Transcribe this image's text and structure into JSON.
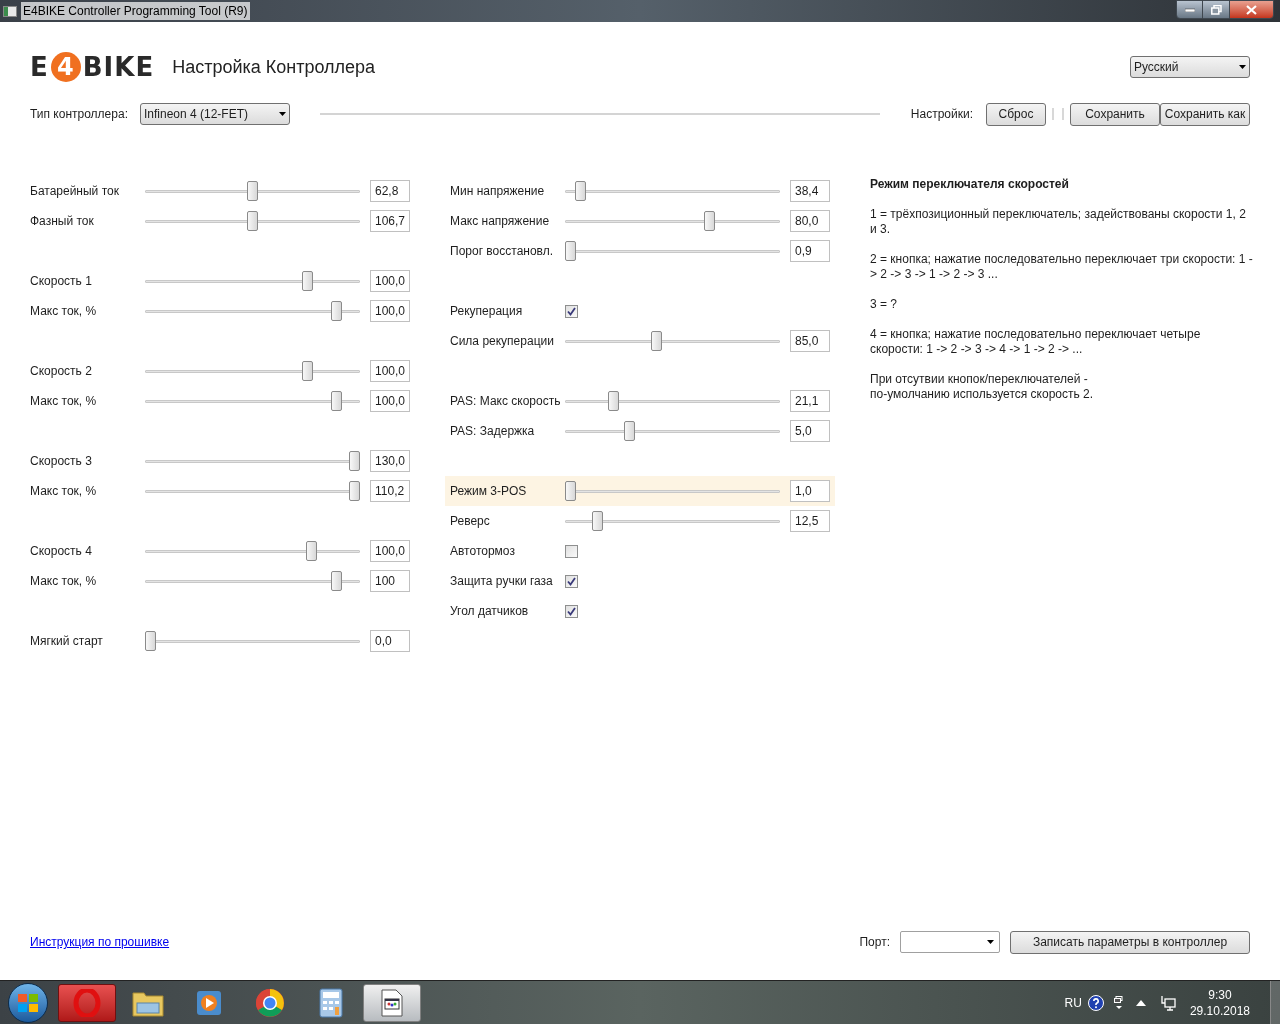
{
  "window": {
    "title": "E4BIKE Controller Programming Tool (R9)"
  },
  "header": {
    "logo": {
      "left": "E",
      "badge": "4",
      "right": "BIKE"
    },
    "title": "Настройка Контроллера",
    "language": {
      "value": "Русский"
    }
  },
  "toolbar": {
    "controller_label": "Тип контроллера:",
    "controller": {
      "value": "Infineon 4 (12-FET)"
    },
    "settings_label": "Настройки:",
    "buttons": [
      "Сброс",
      "Сохранить",
      "Сохранить как"
    ]
  },
  "columns": [
    {
      "groups": [
        [
          {
            "kind": "slider",
            "label": "Батарейный ток",
            "level": 0.5,
            "value": "62,8",
            "highlighted": false
          },
          {
            "kind": "slider",
            "label": "Фазный ток",
            "level": 0.5,
            "value": "106,7",
            "highlighted": false
          }
        ],
        [
          {
            "kind": "slider",
            "label": "Скорость 1",
            "level": 0.77,
            "value": "100,0",
            "highlighted": false
          },
          {
            "kind": "slider",
            "label": "Макс ток, %",
            "level": 0.91,
            "value": "100,0",
            "highlighted": false
          }
        ],
        [
          {
            "kind": "slider",
            "label": "Скорость 2",
            "level": 0.77,
            "value": "100,0",
            "highlighted": false
          },
          {
            "kind": "slider",
            "label": "Макс ток, %",
            "level": 0.91,
            "value": "100,0",
            "highlighted": false
          }
        ],
        [
          {
            "kind": "slider",
            "label": "Скорость 3",
            "level": 1,
            "value": "130,0",
            "highlighted": false
          },
          {
            "kind": "slider",
            "label": "Макс ток, %",
            "level": 1,
            "value": "110,2",
            "highlighted": false
          }
        ],
        [
          {
            "kind": "slider",
            "label": "Скорость 4",
            "level": 0.79,
            "value": "100,0",
            "highlighted": false
          },
          {
            "kind": "slider",
            "label": "Макс ток, %",
            "level": 0.91,
            "value": "100",
            "highlighted": false
          }
        ],
        [
          {
            "kind": "slider",
            "label": "Мягкий старт",
            "level": 0,
            "value": "0,0",
            "highlighted": false
          }
        ]
      ]
    },
    {
      "groups": [
        [
          {
            "kind": "slider",
            "label": "Мин напряжение",
            "level": 0.05,
            "value": "38,4",
            "highlighted": false
          },
          {
            "kind": "slider",
            "label": "Макс напряжение",
            "level": 0.68,
            "value": "80,0",
            "highlighted": false
          },
          {
            "kind": "slider",
            "label": "Порог восстановл.",
            "level": 0,
            "value": "0,9",
            "highlighted": false
          }
        ],
        [
          {
            "kind": "checkbox",
            "label": "Рекуперация",
            "checked": true
          },
          {
            "kind": "slider",
            "label": "Сила рекуперации",
            "level": 0.42,
            "value": "85,0",
            "highlighted": false
          }
        ],
        [
          {
            "kind": "slider",
            "label": "PAS: Макс скорость",
            "level": 0.21,
            "value": "21,1",
            "highlighted": false
          },
          {
            "kind": "slider",
            "label": "PAS: Задержка",
            "level": 0.29,
            "value": "5,0",
            "highlighted": false
          }
        ],
        [
          {
            "kind": "slider",
            "label": "Режим 3-POS",
            "level": 0,
            "value": "1,0",
            "highlighted": true
          },
          {
            "kind": "slider",
            "label": "Реверс",
            "level": 0.13,
            "value": "12,5",
            "highlighted": false
          },
          {
            "kind": "checkbox",
            "label": "Автотормоз",
            "checked": false
          },
          {
            "kind": "checkbox",
            "label": "Защита ручки газа",
            "checked": true
          },
          {
            "kind": "checkbox",
            "label": "Угол датчиков",
            "checked": true
          }
        ]
      ]
    }
  ],
  "help": {
    "title": "Режим переключателя скоростей",
    "paragraphs": [
      "1 = трёхпозиционный переключатель; задействованы скорости 1, 2 и 3.",
      "2 = кнопка; нажатие последовательно переключает три скорости:   1 -> 2 -> 3 -> 1 -> 2 -> 3 ...",
      "3 = ?",
      "4 = кнопка; нажатие последовательно переключает четыре скорости:   1 -> 2 -> 3 -> 4 -> 1 -> 2 -> ...",
      "При отсутвии кнопок/переключателей -\nпо-умолчанию используется скорость 2."
    ]
  },
  "footer": {
    "link": "Инструкция по прошивке",
    "port_label": "Порт:",
    "write_button": "Записать параметры в контроллер"
  },
  "taskbar": {
    "language": "RU",
    "time": "9:30",
    "date": "29.10.2018"
  }
}
